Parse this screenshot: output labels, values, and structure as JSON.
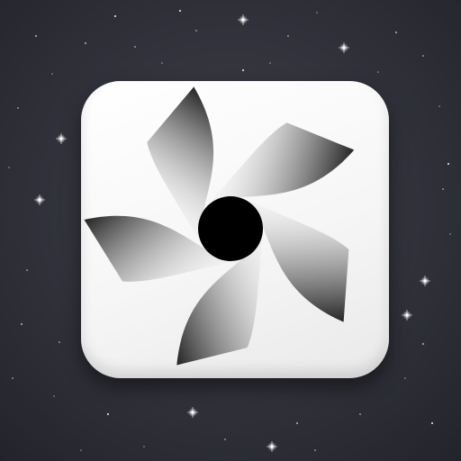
{
  "background": {
    "color_center": "#3f4048",
    "color_edge": "#23242b",
    "star_color": "#ffffff"
  },
  "app_icon": {
    "icon": "aperture-swirl-icon",
    "tile_color": "#ffffff",
    "center_color": "#000000",
    "blade_count": 5
  }
}
